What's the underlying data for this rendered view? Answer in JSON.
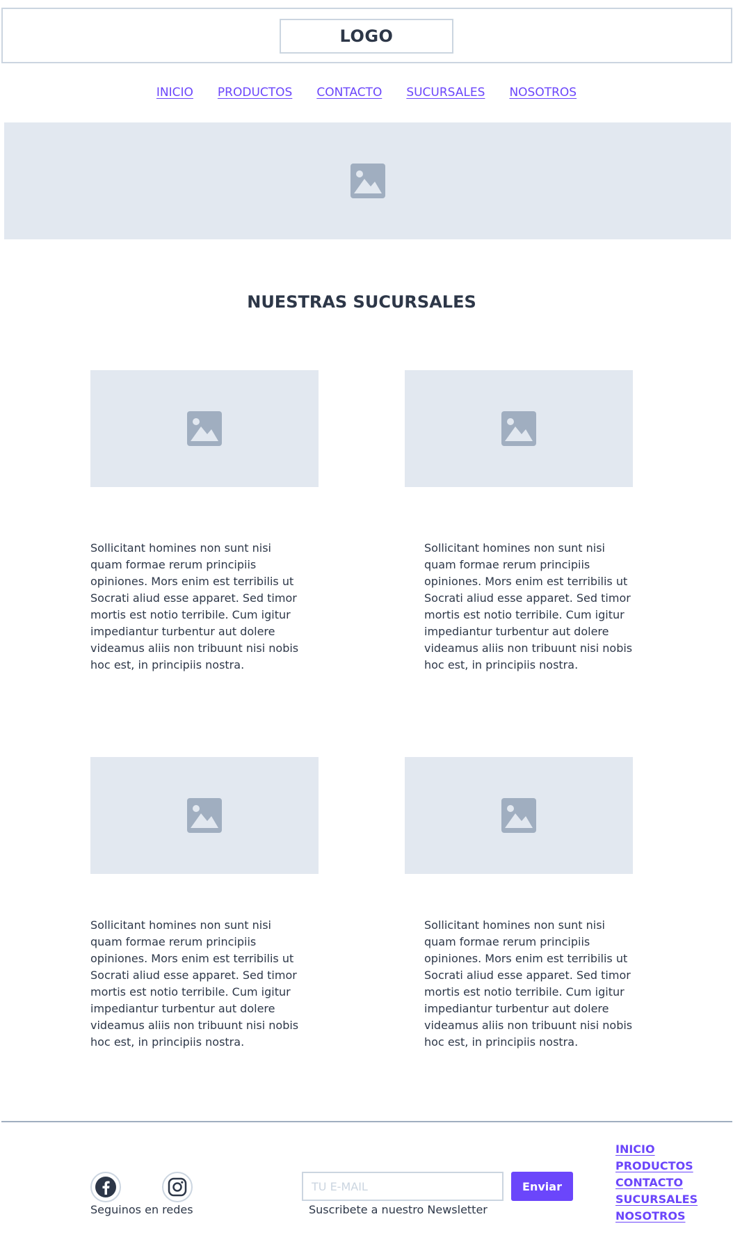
{
  "header": {
    "logo_text": "LOGO"
  },
  "nav": {
    "items": [
      {
        "label": "INICIO"
      },
      {
        "label": "PRODUCTOS"
      },
      {
        "label": "CONTACTO"
      },
      {
        "label": "SUCURSALES"
      },
      {
        "label": "NOSOTROS"
      }
    ]
  },
  "hero": {
    "icon": "image-placeholder-icon"
  },
  "main": {
    "title": "NUESTRAS SUCURSALES",
    "cards": [
      {
        "icon": "image-placeholder-icon",
        "text": "Sollicitant homines non sunt nisi quam formae rerum principiis opiniones. Mors enim est terribilis ut Socrati aliud esse apparet. Sed timor mortis est notio terribile. Cum igitur impediantur turbentur aut dolere videamus aliis non tribuunt nisi nobis hoc est, in principiis nostra."
      },
      {
        "icon": "image-placeholder-icon",
        "text": "Sollicitant homines non sunt nisi quam formae rerum principiis opiniones. Mors enim est terribilis ut Socrati aliud esse apparet. Sed timor mortis est notio terribile. Cum igitur impediantur turbentur aut dolere videamus aliis non tribuunt nisi nobis hoc est, in principiis nostra."
      },
      {
        "icon": "image-placeholder-icon",
        "text": "Sollicitant homines non sunt nisi quam formae rerum principiis opiniones. Mors enim est terribilis ut Socrati aliud esse apparet. Sed timor mortis est notio terribile. Cum igitur impediantur turbentur aut dolere videamus aliis non tribuunt nisi nobis hoc est, in principiis nostra."
      },
      {
        "icon": "image-placeholder-icon",
        "text": "Sollicitant homines non sunt nisi quam formae rerum principiis opiniones. Mors enim est terribilis ut Socrati aliud esse apparet. Sed timor mortis est notio terribile. Cum igitur impediantur turbentur aut dolere videamus aliis non tribuunt nisi nobis hoc est, in principiis nostra."
      }
    ]
  },
  "footer": {
    "social": {
      "icons": [
        "facebook-icon",
        "instagram-icon"
      ],
      "label": "Seguinos en redes"
    },
    "newsletter": {
      "placeholder": "TU E-MAIL",
      "value": "",
      "button_label": "Enviar",
      "label": "Suscribete a nuestro Newsletter"
    },
    "links": [
      {
        "label": "INICIO"
      },
      {
        "label": "PRODUCTOS"
      },
      {
        "label": "CONTACTO"
      },
      {
        "label": "SUCURSALES"
      },
      {
        "label": "NOSOTROS"
      }
    ]
  },
  "colors": {
    "accent": "#6b46fb",
    "placeholder_bg": "#e2e8f0",
    "placeholder_icon": "#a0aec0",
    "border": "#cbd5e0",
    "text": "#2d3748"
  }
}
